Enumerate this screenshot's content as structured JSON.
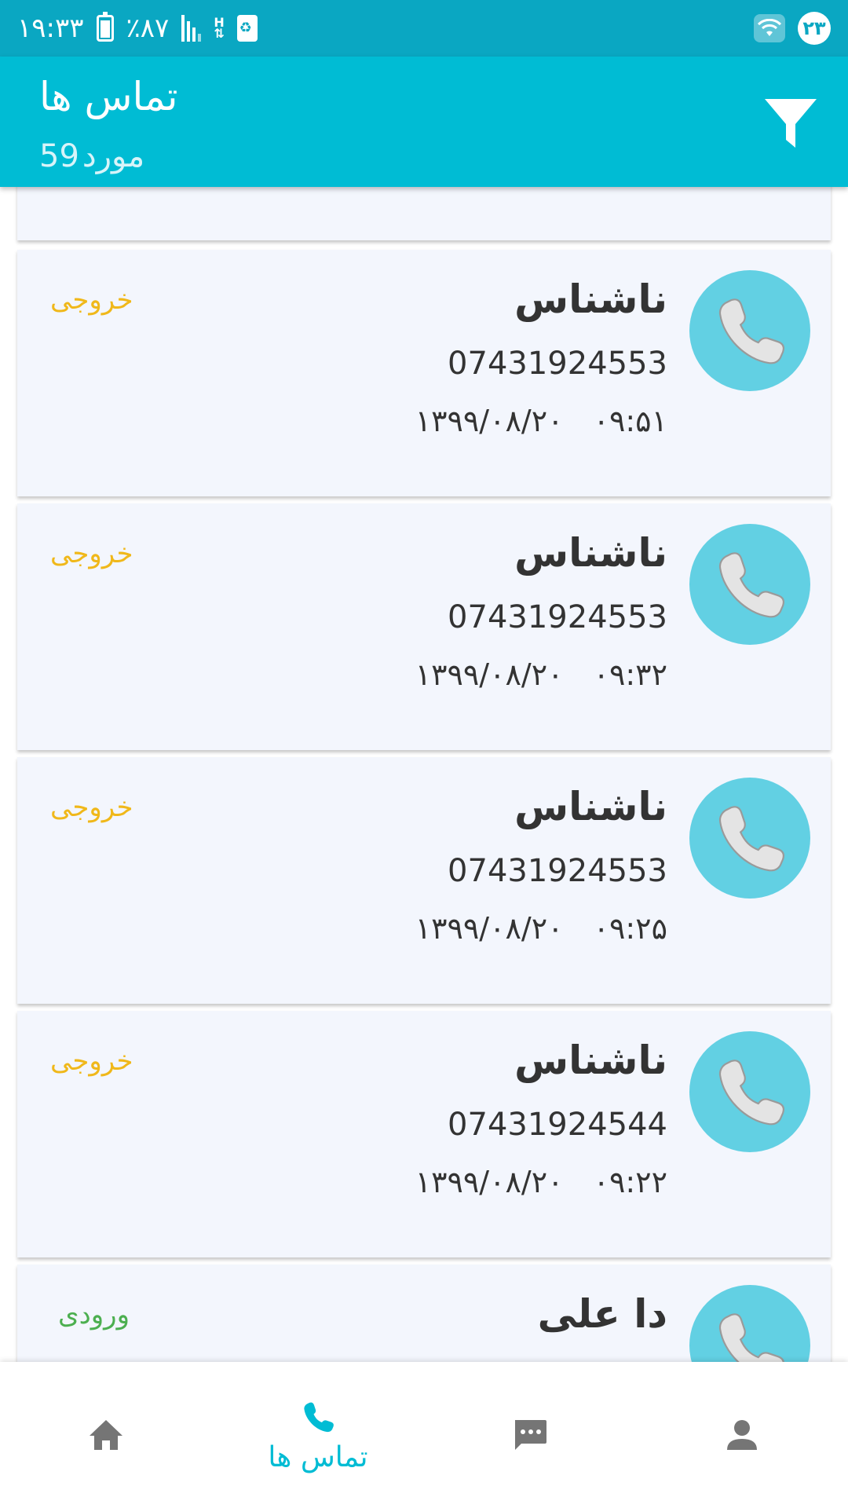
{
  "status_bar": {
    "time": "۱۹:۳۳",
    "battery": "٪۸۷",
    "network_type": "H",
    "notification_count": "۲۳"
  },
  "app_bar": {
    "title": "تماس ها",
    "count_number": "59",
    "count_unit": "مورد"
  },
  "calls": [
    {
      "name": "ناشناس",
      "number": "07431924553",
      "date": "۱۳۹۹/۰۸/۲۰",
      "time": "۰۹:۵۱",
      "type": "خروجی",
      "direction": "out"
    },
    {
      "name": "ناشناس",
      "number": "07431924553",
      "date": "۱۳۹۹/۰۸/۲۰",
      "time": "۰۹:۳۲",
      "type": "خروجی",
      "direction": "out"
    },
    {
      "name": "ناشناس",
      "number": "07431924553",
      "date": "۱۳۹۹/۰۸/۲۰",
      "time": "۰۹:۲۵",
      "type": "خروجی",
      "direction": "out"
    },
    {
      "name": "ناشناس",
      "number": "07431924544",
      "date": "۱۳۹۹/۰۸/۲۰",
      "time": "۰۹:۲۲",
      "type": "خروجی",
      "direction": "out"
    },
    {
      "name": "دا علی",
      "type": "ورودی",
      "direction": "in"
    }
  ],
  "bottom_nav": {
    "calls_label": "تماس ها",
    "icons": [
      "home-icon",
      "phone-icon",
      "message-icon",
      "person-icon"
    ],
    "active": "phone-icon"
  },
  "colors": {
    "primary": "#00bcd4",
    "status_bar": "#0aa7c2",
    "avatar": "#62d0e3",
    "card_bg": "#f3f6fd",
    "outgoing": "#f0b81a",
    "incoming": "#4caf50",
    "nav_inactive": "#757575"
  }
}
